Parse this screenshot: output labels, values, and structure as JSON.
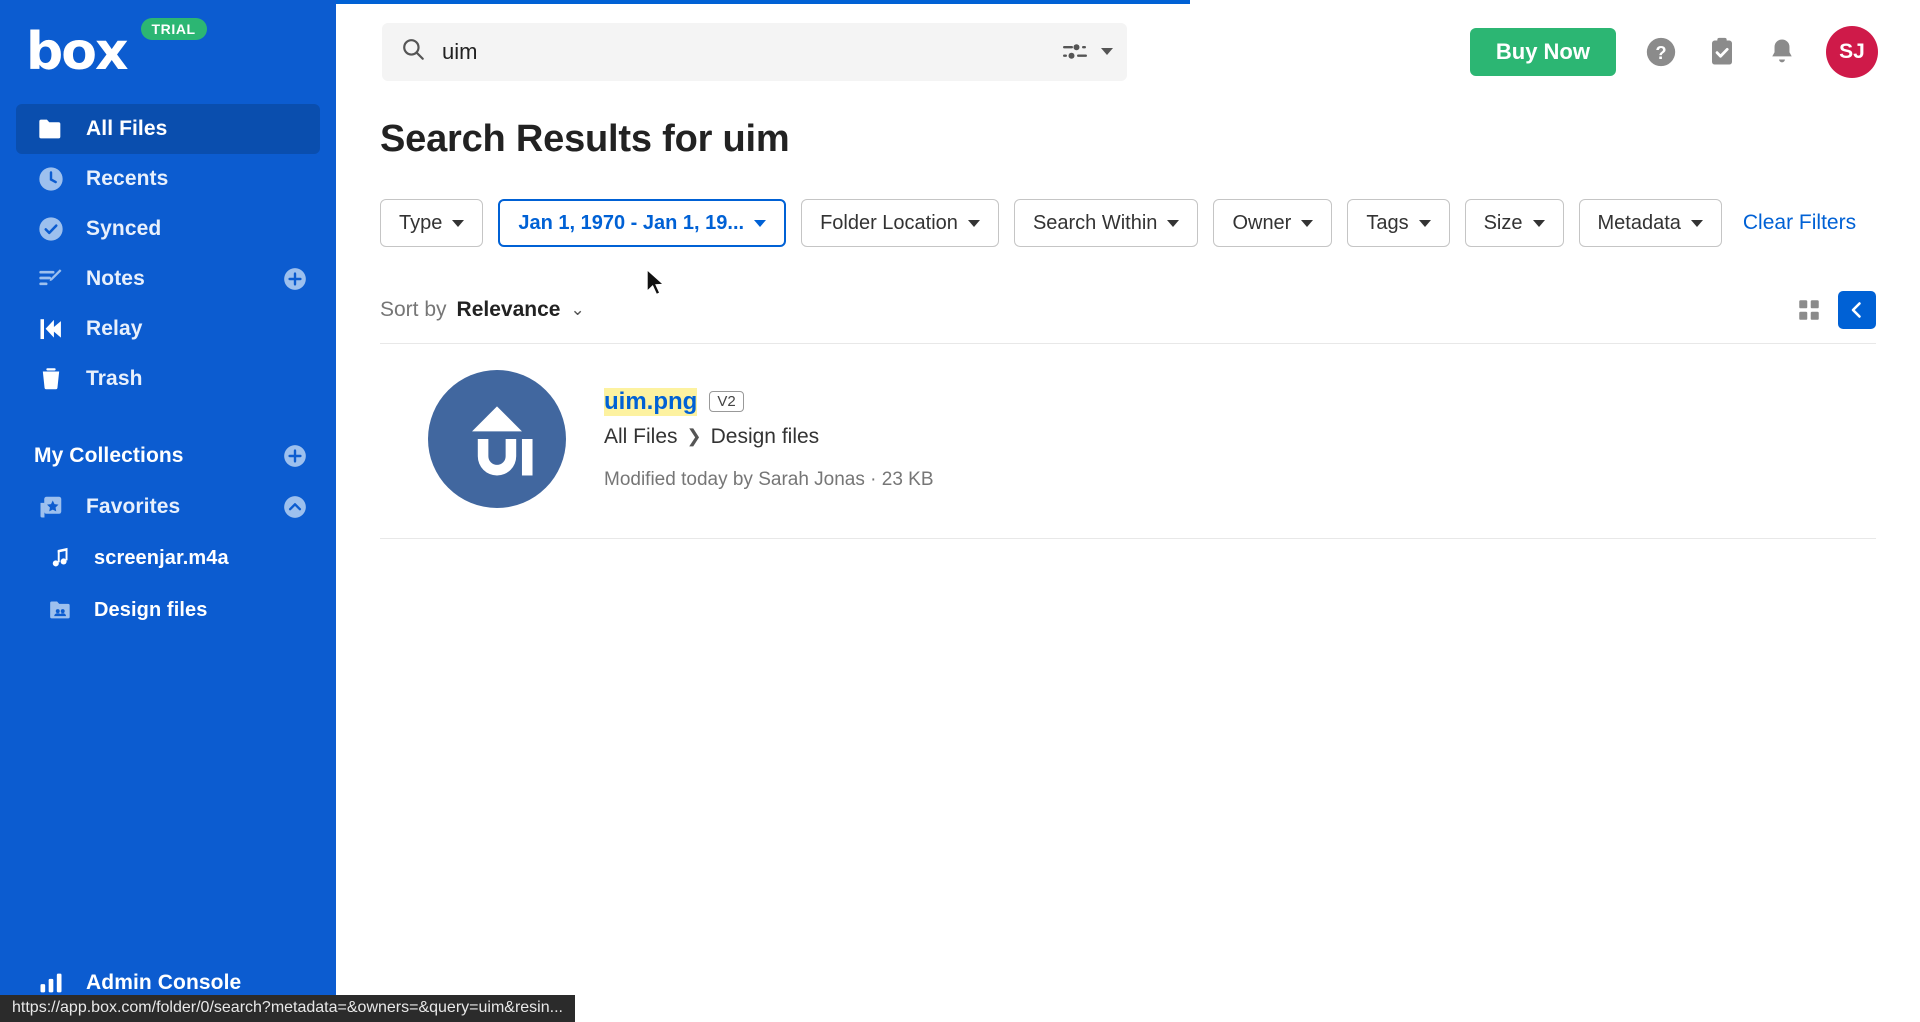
{
  "brand": {
    "logo_text": "box",
    "trial_badge": "TRIAL",
    "accent_blue": "#0061d5",
    "sidebar_blue": "#0c5cd0",
    "green": "#2cb673",
    "avatar_red": "#cf1a49"
  },
  "sidebar": {
    "items": [
      {
        "label": "All Files",
        "icon": "folder-icon",
        "active": true
      },
      {
        "label": "Recents",
        "icon": "clock-icon",
        "active": false
      },
      {
        "label": "Synced",
        "icon": "check-circle-icon",
        "active": false
      },
      {
        "label": "Notes",
        "icon": "notes-icon",
        "active": false,
        "add": true
      },
      {
        "label": "Relay",
        "icon": "relay-icon",
        "active": false
      },
      {
        "label": "Trash",
        "icon": "trash-icon",
        "active": false
      }
    ],
    "collections_header": "My Collections",
    "favorites": {
      "label": "Favorites",
      "icon": "favorites-icon"
    },
    "files": [
      {
        "label": "screenjar.m4a",
        "icon": "audio-file-icon"
      },
      {
        "label": "Design files",
        "icon": "shared-folder-icon"
      }
    ],
    "admin": {
      "label": "Admin Console",
      "icon": "bar-chart-icon"
    }
  },
  "header": {
    "search": {
      "value": "uim",
      "placeholder": "Search files and folders"
    },
    "search_tools_icon": "sliders-icon",
    "buy_now_label": "Buy Now",
    "icons": [
      "help-icon",
      "tasks-clipboard-icon",
      "notifications-bell-icon"
    ],
    "avatar_initials": "SJ"
  },
  "page": {
    "title": "Search Results for uim"
  },
  "filters": {
    "chips": [
      {
        "label": "Type",
        "active": false
      },
      {
        "label": "Jan 1, 1970 - Jan 1, 19...",
        "active": true
      },
      {
        "label": "Folder Location",
        "active": false
      },
      {
        "label": "Search Within",
        "active": false
      },
      {
        "label": "Owner",
        "active": false
      },
      {
        "label": "Tags",
        "active": false
      },
      {
        "label": "Size",
        "active": false
      },
      {
        "label": "Metadata",
        "active": false
      }
    ],
    "clear_label": "Clear Filters"
  },
  "sort": {
    "label": "Sort by",
    "value": "Relevance"
  },
  "view": {
    "grid_icon": "grid-view-icon",
    "list_icon": "collapse-sidebar-icon"
  },
  "results": [
    {
      "name": "uim.png",
      "version_badge": "V2",
      "thumb_text": "UI",
      "breadcrumb_root": "All Files",
      "breadcrumb_folder": "Design files",
      "meta": "Modified today by Sarah Jonas · 23 KB"
    }
  ],
  "statusbar": {
    "url": "https://app.box.com/folder/0/search?metadata=&owners=&query=uim&resin..."
  }
}
